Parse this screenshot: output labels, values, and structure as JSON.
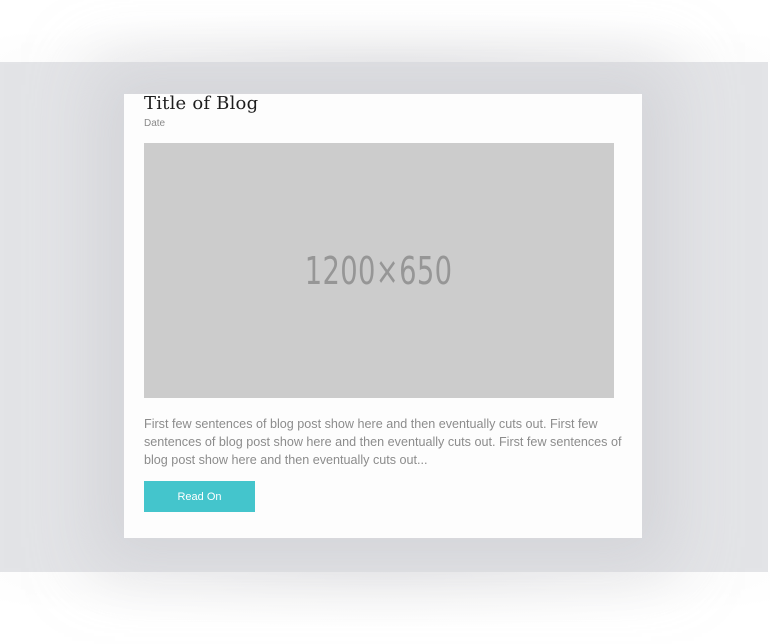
{
  "blog_card": {
    "title": "Title of Blog",
    "date": "Date",
    "image_placeholder_text": "1200×650",
    "excerpt": "First few sentences of blog post show here and then eventually cuts out. First few sentences of blog post show here and then eventually cuts out. First few sentences of blog post show here and then eventually cuts out...",
    "read_on_label": "Read On"
  },
  "colors": {
    "band_background": "#e3e4e7",
    "card_background": "#fdfdfd",
    "image_placeholder": "#cccccc",
    "button_accent": "#44c5cc",
    "title_text": "#1d1d1d",
    "body_text": "#8c8c8c"
  }
}
